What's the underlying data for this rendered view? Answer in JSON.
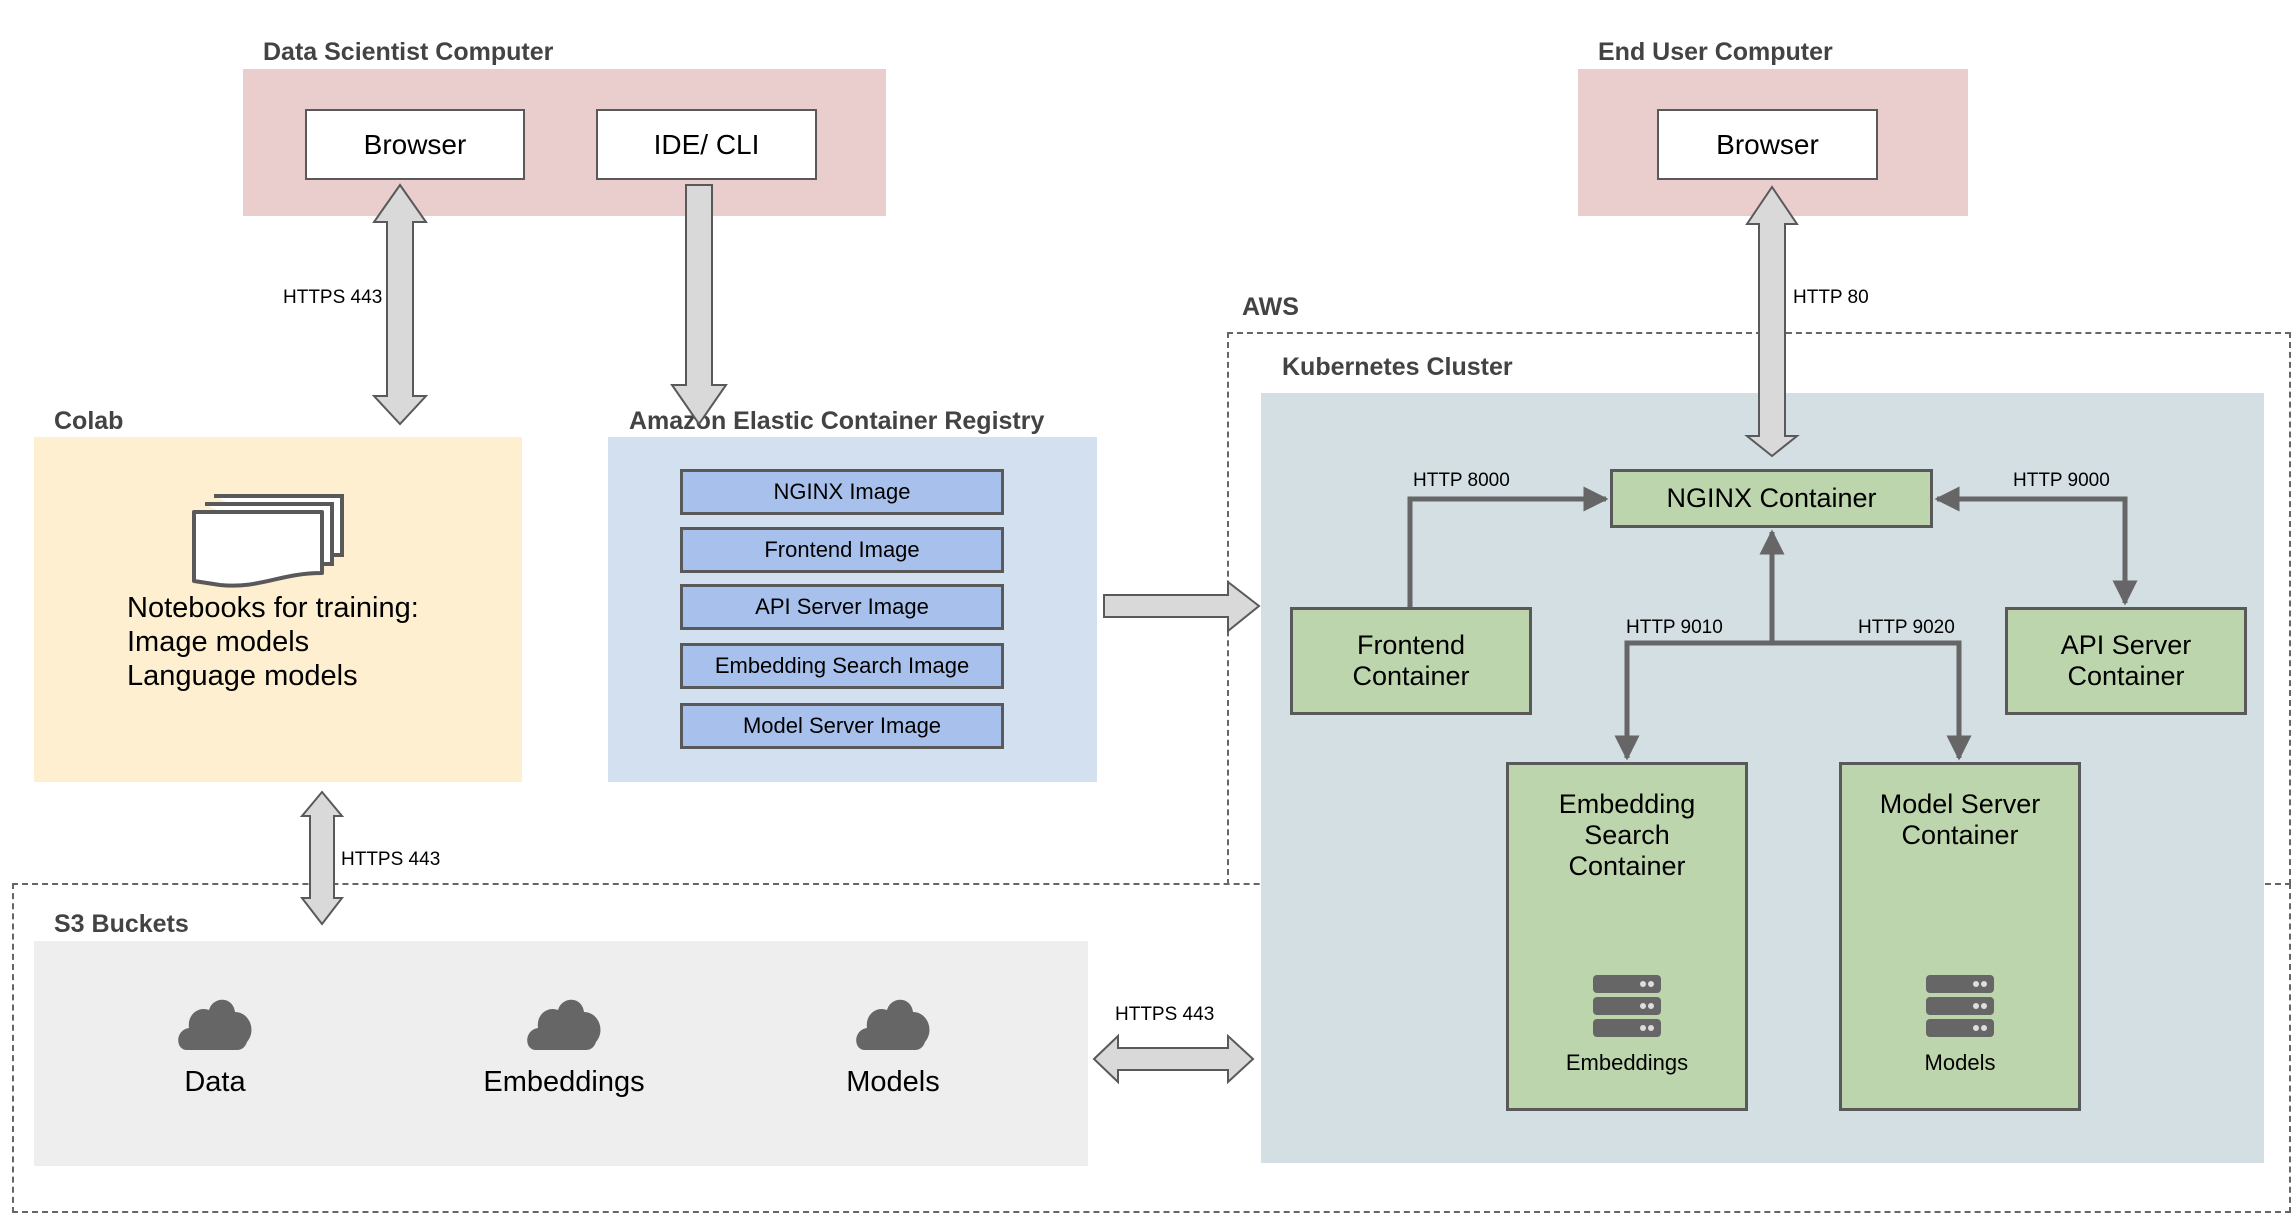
{
  "data_scientist": {
    "title": "Data Scientist Computer",
    "browser": "Browser",
    "ide": "IDE/ CLI"
  },
  "end_user": {
    "title": "End User Computer",
    "browser": "Browser"
  },
  "colab": {
    "title": "Colab",
    "icon": "notebooks-icon",
    "lines": [
      "Notebooks for training:",
      "Image models",
      "Language models"
    ]
  },
  "ecr": {
    "title": "Amazon Elastic Container Registry",
    "images": [
      "NGINX Image",
      "Frontend Image",
      "API Server Image",
      "Embedding Search Image",
      "Model Server Image"
    ]
  },
  "aws": {
    "title": "AWS"
  },
  "kubernetes": {
    "title": "Kubernetes Cluster",
    "nginx": "NGINX Container",
    "frontend": [
      "Frontend",
      "Container"
    ],
    "api": [
      "API Server",
      "Container"
    ],
    "embedding": [
      "Embedding",
      "Search",
      "Container"
    ],
    "embedding_store": "Embeddings",
    "model_server": [
      "Model Server",
      "Container"
    ],
    "model_store": "Models"
  },
  "s3": {
    "title": "S3 Buckets",
    "buckets": [
      "Data",
      "Embeddings",
      "Models"
    ]
  },
  "connections": {
    "ds_browser_colab": "HTTPS 443",
    "enduser_nginx": "HTTP 80",
    "frontend_nginx": "HTTP 8000",
    "nginx_api": "HTTP 9000",
    "nginx_embedding": "HTTP 9010",
    "nginx_model": "HTTP 9020",
    "colab_s3": "HTTPS 443",
    "s3_k8s": "HTTPS 443"
  },
  "colors": {
    "computer_bg": "#eacdcd",
    "colab_bg": "#fdefcf",
    "ecr_bg": "#d3e0ef",
    "image_bar": "#a8c1ec",
    "k8s_bg": "#d3dfe3",
    "container": "#bdd5ad",
    "s3_bg": "#eeeeee",
    "arrow_fill": "#d9d9d9",
    "line": "#666666"
  }
}
